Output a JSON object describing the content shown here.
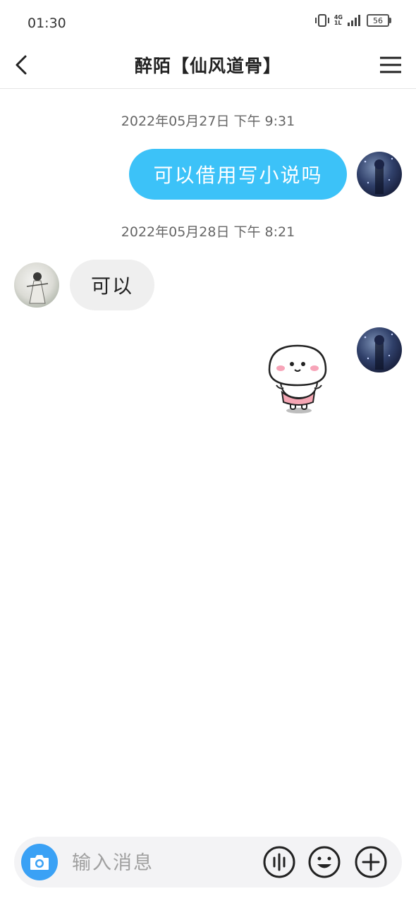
{
  "status_bar": {
    "time": "01:30",
    "network_top": "4G",
    "network_bottom": "1L",
    "battery": "56"
  },
  "header": {
    "title": "醉陌【仙风道骨】"
  },
  "messages": [
    {
      "type": "timestamp",
      "text": "2022年05月27日 下午 9:31"
    },
    {
      "type": "outgoing",
      "text": "可以借用写小说吗"
    },
    {
      "type": "timestamp",
      "text": "2022年05月28日 下午 8:21"
    },
    {
      "type": "incoming",
      "text": "可以"
    },
    {
      "type": "outgoing-sticker",
      "sticker": "smiling-dumpling-sticker"
    }
  ],
  "input": {
    "placeholder": "输入消息"
  },
  "icons": {
    "back": "chevron-left-icon",
    "menu": "hamburger-menu-icon",
    "camera": "camera-icon",
    "voice": "voice-wave-icon",
    "emoji": "emoji-icon",
    "plus": "plus-icon"
  },
  "colors": {
    "accent": "#3cc2f8",
    "camera_button": "#3aa1f5",
    "incoming_bubble": "#efefef",
    "input_bar": "#f3f3f5"
  }
}
